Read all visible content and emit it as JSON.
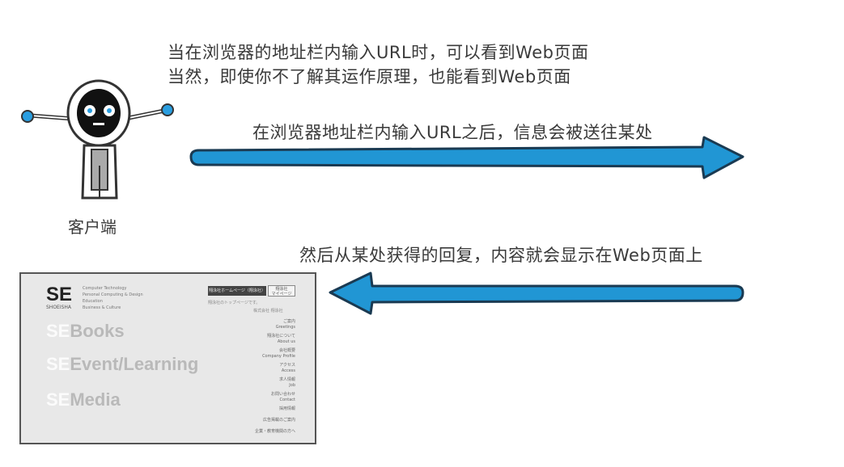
{
  "texts": {
    "intro_line1": "当在浏览器的地址栏内输入URL时，可以看到Web页面",
    "intro_line2": "当然，即使你不了解其运作原理，也能看到Web页面",
    "request_text": "在浏览器地址栏内输入URL之后，信息会被送往某处",
    "response_text": "然后从某处获得的回复，内容就会显示在Web页面上",
    "client_label": "客户端"
  },
  "colors": {
    "arrow_fill": "#2196d4",
    "arrow_outline": "#1a3a52",
    "page_bg": "#e8e8e8"
  },
  "webpage": {
    "logo": "SE",
    "logo_sub": "SHOEISHA",
    "tagline": [
      "Computer Technology",
      "Personal Computing & Design",
      "Education",
      "Business & Culture"
    ],
    "button_dark": "翔泳社ホームページ（翔泳社）",
    "button_light": [
      "翔泳社",
      "マイページ"
    ],
    "note": "翔泳社のトップページです。",
    "company": "株式会社 翔泳社",
    "menu": [
      [
        "ご案内",
        "Greetings"
      ],
      [
        "翔泳社について",
        "About us"
      ],
      [
        "会社概要",
        "Company Profile"
      ],
      [
        "アクセス",
        "Access"
      ],
      [
        "求人情報",
        "Job"
      ],
      [
        "お問い合わせ",
        "Contact"
      ],
      [
        "採用情報",
        ""
      ],
      [
        "広告掲載のご案内",
        ""
      ],
      [
        "企業・教育機関の方へ",
        ""
      ]
    ],
    "nav": [
      {
        "mark": "SE",
        "label": "Books"
      },
      {
        "mark": "SE",
        "label": "Event/Learning"
      },
      {
        "mark": "SE",
        "label": "Media"
      }
    ]
  }
}
